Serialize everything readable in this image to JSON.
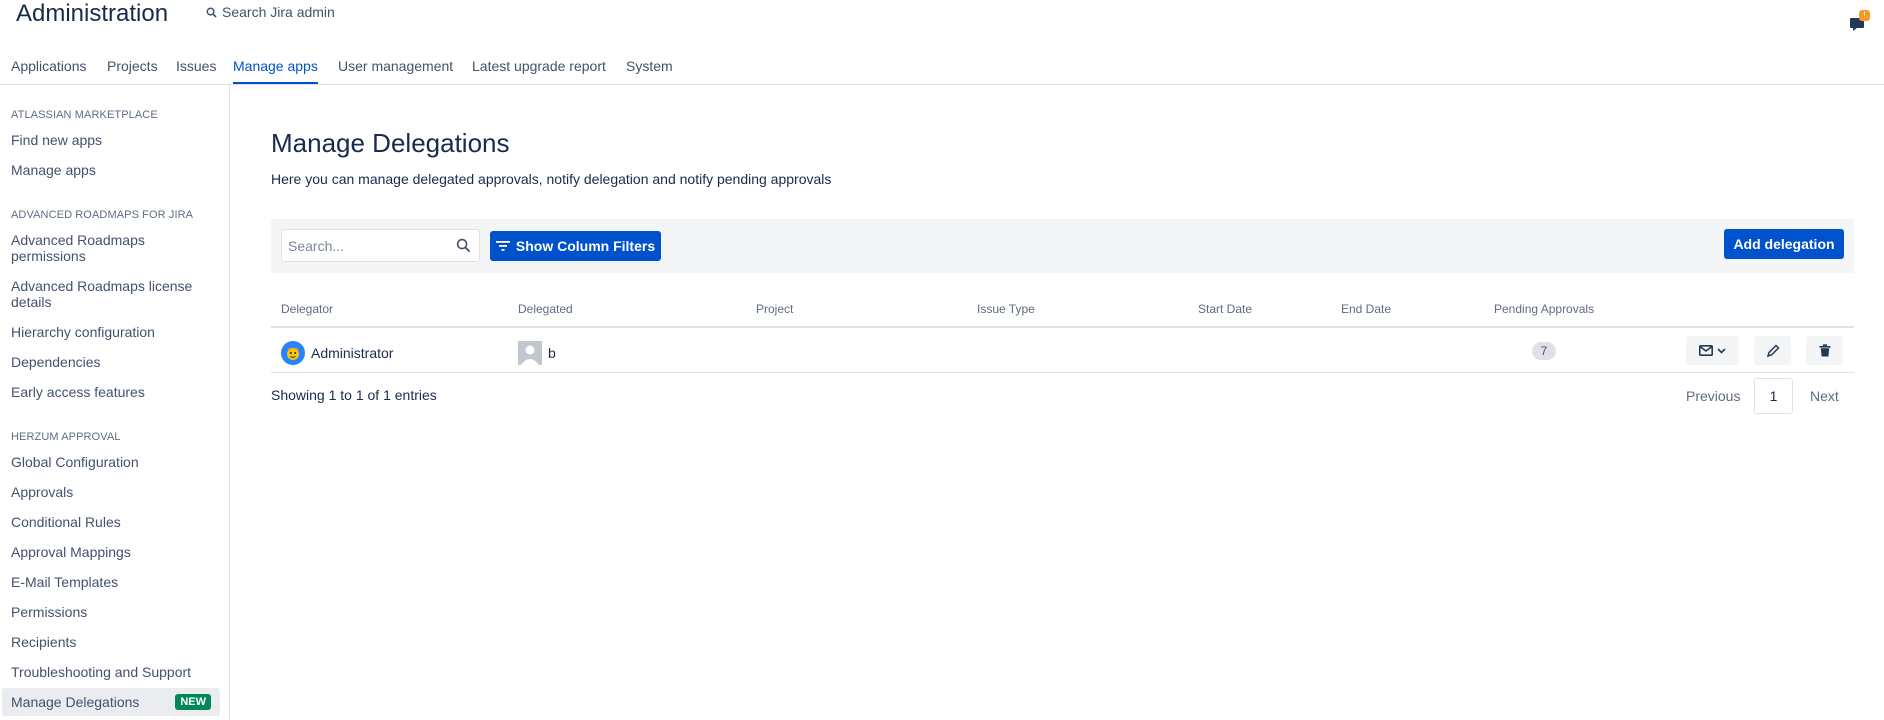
{
  "header": {
    "title": "Administration",
    "search_label": "Search Jira admin",
    "notification_count": "!"
  },
  "nav": {
    "tabs": [
      {
        "label": "Applications"
      },
      {
        "label": "Projects"
      },
      {
        "label": "Issues"
      },
      {
        "label": "Manage apps"
      },
      {
        "label": "User management"
      },
      {
        "label": "Latest upgrade report"
      },
      {
        "label": "System"
      }
    ],
    "active": "Manage apps"
  },
  "sidebar": {
    "sections": [
      {
        "title": "ATLASSIAN MARKETPLACE",
        "items": [
          "Find new apps",
          "Manage apps"
        ]
      },
      {
        "title": "ADVANCED ROADMAPS FOR JIRA",
        "items": [
          "Advanced Roadmaps permissions",
          "Advanced Roadmaps license details",
          "Hierarchy configuration",
          "Dependencies",
          "Early access features"
        ]
      },
      {
        "title": "HERZUM APPROVAL",
        "items": [
          "Global Configuration",
          "Approvals",
          "Conditional Rules",
          "Approval Mappings",
          "E-Mail Templates",
          "Permissions",
          "Recipients",
          "Troubleshooting and Support",
          "Manage Delegations"
        ]
      }
    ],
    "active_badge": "NEW"
  },
  "main": {
    "title": "Manage Delegations",
    "description": "Here you can manage delegated approvals, notify delegation and notify pending approvals",
    "search_placeholder": "Search...",
    "filters_label": "Show Column Filters",
    "add_label": "Add delegation"
  },
  "table": {
    "columns": [
      "Delegator",
      "Delegated",
      "Project",
      "Issue Type",
      "Start Date",
      "End Date",
      "Pending Approvals"
    ],
    "rows": [
      {
        "delegator": "Administrator",
        "delegated": "b",
        "project": "",
        "issue_type": "",
        "start_date": "",
        "end_date": "",
        "pending": "7"
      }
    ]
  },
  "footer": {
    "showing": "Showing 1 to 1 of 1 entries",
    "previous": "Previous",
    "page": "1",
    "next": "Next"
  },
  "colors": {
    "accent": "#0052cc",
    "text": "#172b4d",
    "badge_green": "#00875a",
    "notification": "#ff991f"
  }
}
